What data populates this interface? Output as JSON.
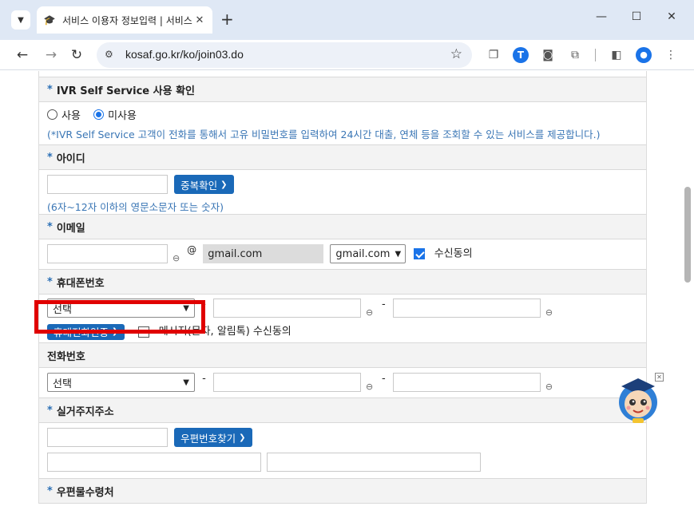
{
  "browser": {
    "tab_title": "서비스 이용자 정보입력 | 서비스 이용",
    "url": "kosaf.go.kr/ko/join03.do"
  },
  "form": {
    "ivr": {
      "label": "IVR Self Service 사용 확인",
      "option_use": "사용",
      "option_nonuse": "미사용",
      "selected": "미사용",
      "note": "(*IVR Self Service 고객이 전화를 통해서 고유 비밀번호를 입력하여 24시간 대출, 연체 등을 조회할 수 있는 서비스를 제공합니다.)"
    },
    "userid": {
      "label": "아이디",
      "check_button": "중복확인",
      "note": "(6자~12자 이하의 영문소문자 또는 숫자)"
    },
    "email": {
      "label": "이메일",
      "at": "@",
      "domain_value": "gmail.com",
      "domain_select": "gmail.com",
      "consent_label": "수신동의"
    },
    "mobile": {
      "label": "휴대폰번호",
      "select_value": "선택",
      "dash": "-",
      "verify_button": "휴대전화인증",
      "sms_consent": "메시지(문자, 알림톡) 수신동의"
    },
    "phone": {
      "label": "전화번호",
      "select_value": "선택",
      "dash": "-"
    },
    "address": {
      "label": "실거주지주소",
      "zip_button": "우편번호찾기"
    },
    "mail_recipient": {
      "label": "우편물수령처"
    },
    "required_mark": "*"
  },
  "colors": {
    "accent": "#1a69b8",
    "highlight": "#e00000",
    "note": "#3a76b5"
  }
}
